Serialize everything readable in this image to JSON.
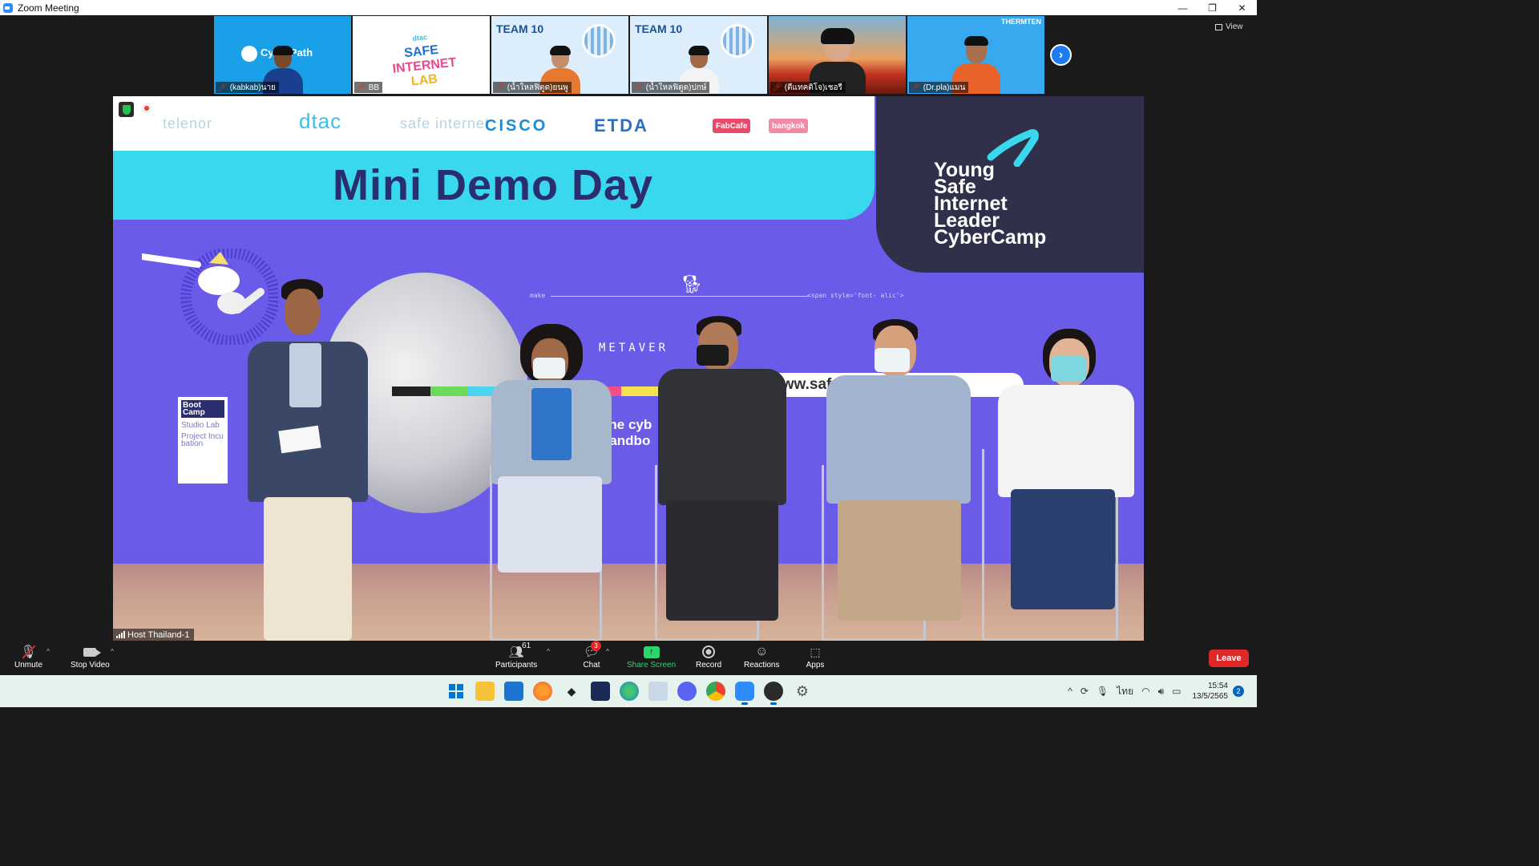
{
  "window": {
    "title": "Zoom Meeting",
    "controls": {
      "minimize": "—",
      "maximize": "❐",
      "close": "✕"
    }
  },
  "thumbnails": [
    {
      "name": "(kabkab)นาย",
      "muted": true,
      "label": "CyberPath",
      "bg": "#1aa0e8"
    },
    {
      "name": "BB",
      "muted": true,
      "label_lines": [
        "SAFE",
        "INTERNET",
        "LAB"
      ],
      "brand": "dtac",
      "bg": "#ffffff"
    },
    {
      "name": "(น้ำใหลฟิตูด)ยนพู",
      "muted": true,
      "label": "TEAM 10",
      "bg": "#dceefb"
    },
    {
      "name": "(น้ำใหลฟิตูด)ปกษ์",
      "muted": true,
      "label": "TEAM 10",
      "bg": "#dceefb"
    },
    {
      "name": "(ตีแทคติโจ)เชอรี",
      "muted": true,
      "label": "",
      "bg": "#e9a060"
    },
    {
      "name": "(Dr.pla)แมน",
      "muted": true,
      "label": "THERMTEN",
      "bg": "#38a8ef"
    }
  ],
  "view_button": {
    "label": "View"
  },
  "main_video": {
    "sponsors": [
      "telenor",
      "dtac",
      "safe internet",
      "CISCO",
      "ETDA",
      "FabCafe",
      "bangkok"
    ],
    "stage_title": "Mini Demo Day",
    "camp_title": [
      "Young",
      "Safe",
      "Internet",
      "Leader",
      "CyberCamp"
    ],
    "metaverse": "METAVER",
    "url": "www.safei     etlab.com",
    "sandbox_lines": [
      "The cyb",
      "Sandbo"
    ],
    "side_panel": [
      "Boot Camp",
      "Studio Lab",
      "Project Incu bation"
    ],
    "code_left": "make",
    "code_right": "<span style='font- alic'>",
    "host_tag": "Host Thailand-1",
    "colors": {
      "stage_purple": "#6a5be8",
      "cyan": "#3ad8ee",
      "title_navy": "#2a2e6e"
    }
  },
  "toolbar": {
    "unmute": "Unmute",
    "stop_video": "Stop Video",
    "participants": "Participants",
    "participants_count": "61",
    "chat": "Chat",
    "chat_badge": "3",
    "share_screen": "Share Screen",
    "record": "Record",
    "reactions": "Reactions",
    "apps": "Apps",
    "leave": "Leave"
  },
  "taskbar": {
    "apps": [
      "windows-start",
      "file-explorer",
      "microsoft-store",
      "firefox",
      "dropbox",
      "notepad",
      "edge",
      "photos",
      "discord",
      "chrome",
      "zoom",
      "obs",
      "settings"
    ],
    "tray": {
      "lang": "ไทย",
      "time": "15:54",
      "date": "13/5/2565",
      "notifications": "2"
    }
  }
}
